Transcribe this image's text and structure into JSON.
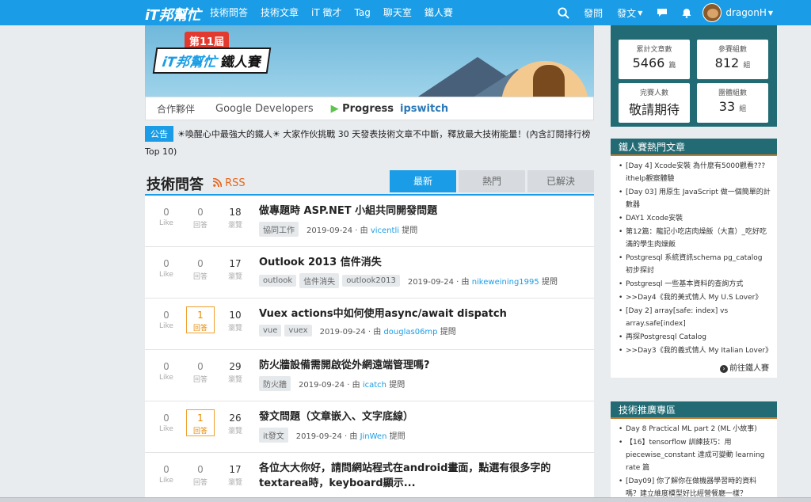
{
  "nav": {
    "logo": "iT邦幫忙",
    "links": [
      "技術問答",
      "技術文章",
      "iT 徵才",
      "Tag",
      "聊天室",
      "鐵人賽"
    ],
    "ask": "發問",
    "post": "發文",
    "username": "dragonH"
  },
  "banner": {
    "badge": "第11屆",
    "title_prefix": "iT邦幫忙",
    "title_suffix": "鐵人賽",
    "partner_label": "合作夥伴",
    "partner_google": "Google Developers",
    "partner_progress": "Progress",
    "partner_ipswitch": "ipswitch"
  },
  "announcement": {
    "tag": "公告",
    "text": "☀喚醒心中最強大的鐵人☀ 大家作伙挑戰 30 天發表技術文章不中斷，釋放最大技術能量！(內含訂閱排行榜 Top 10)"
  },
  "main": {
    "title": "技術問答",
    "rss": "RSS",
    "tabs": [
      "最新",
      "熱門",
      "已解決"
    ]
  },
  "labels": {
    "likes": "Like",
    "answers": "回答",
    "views": "瀏覽",
    "by": "由",
    "asked": "提問"
  },
  "questions": [
    {
      "likes": "0",
      "answers": "0",
      "views": "18",
      "title": "做專題時 ASP.NET 小組共同開發問題",
      "tags": [
        "協同工作"
      ],
      "date": "2019-09-24",
      "user": "vicentli"
    },
    {
      "likes": "0",
      "answers": "0",
      "views": "17",
      "title": "Outlook 2013 信件消失",
      "tags": [
        "outlook",
        "信件消失",
        "outlook2013"
      ],
      "date": "2019-09-24",
      "user": "nikeweining1995"
    },
    {
      "likes": "0",
      "answers": "1",
      "views": "10",
      "title": "Vuex actions中如何使用async/await dispatch",
      "tags": [
        "vue",
        "vuex"
      ],
      "date": "2019-09-24",
      "user": "douglas06mp"
    },
    {
      "likes": "0",
      "answers": "0",
      "views": "29",
      "title": "防火牆設備需開啟從外網遠端管理嗎?",
      "tags": [
        "防火牆"
      ],
      "date": "2019-09-24",
      "user": "icatch"
    },
    {
      "likes": "0",
      "answers": "1",
      "views": "26",
      "title": "發文問題（文章嵌入、文字底線）",
      "tags": [
        "it發文"
      ],
      "date": "2019-09-24",
      "user": "JinWen"
    },
    {
      "likes": "0",
      "answers": "0",
      "views": "17",
      "title": "各位大大你好，請問網站程式在android畫面，點選有很多字的textarea時，keyboard顯示...",
      "tags": [],
      "date": "",
      "user": ""
    }
  ],
  "sidebar": {
    "stats": [
      {
        "label": "累計文章數",
        "value": "5466",
        "unit": "篇"
      },
      {
        "label": "參賽組數",
        "value": "812",
        "unit": "組"
      },
      {
        "label": "完賽人數",
        "value": "敬請期待",
        "unit": ""
      },
      {
        "label": "團體組數",
        "value": "33",
        "unit": "組"
      }
    ],
    "hot_title": "鐵人賽熱門文章",
    "hot_items": [
      "[Day 4] Xcode安裝 為什麼有5000觀看??? ithelp觀察體驗",
      "[Day 03] 用原生 JavaScript 做一個簡單的計數器",
      "DAY1 Xcode安裝",
      "第12篇：龍記小吃店肉燥飯（大直）_吃好吃滿的學生肉燥飯",
      "Postgresql 系統資訊schema pg_catalog 初步探討",
      "Postgresql 一些基本資料的查詢方式",
      ">>Day4《我的美式情人 My U.S Lover》",
      "[Day 2] array[safe: index] vs array.safe[index]",
      "再探Postgresql Catalog",
      ">>Day3《我的義式情人 My Italian Lover》"
    ],
    "hot_more": "前往鐵人賽",
    "rec_title": "技術推廣專區",
    "rec_items": [
      "Day 8 Practical ML part 2 (ML 小故事)",
      "【16】tensorflow 訓練技巧：用 piecewise_constant 達成可變動 learning rate 篇",
      "[Day09] 你了解你在做機器學習時的資料嗎？建立維度模型好比經營餐廳一樣？"
    ]
  }
}
